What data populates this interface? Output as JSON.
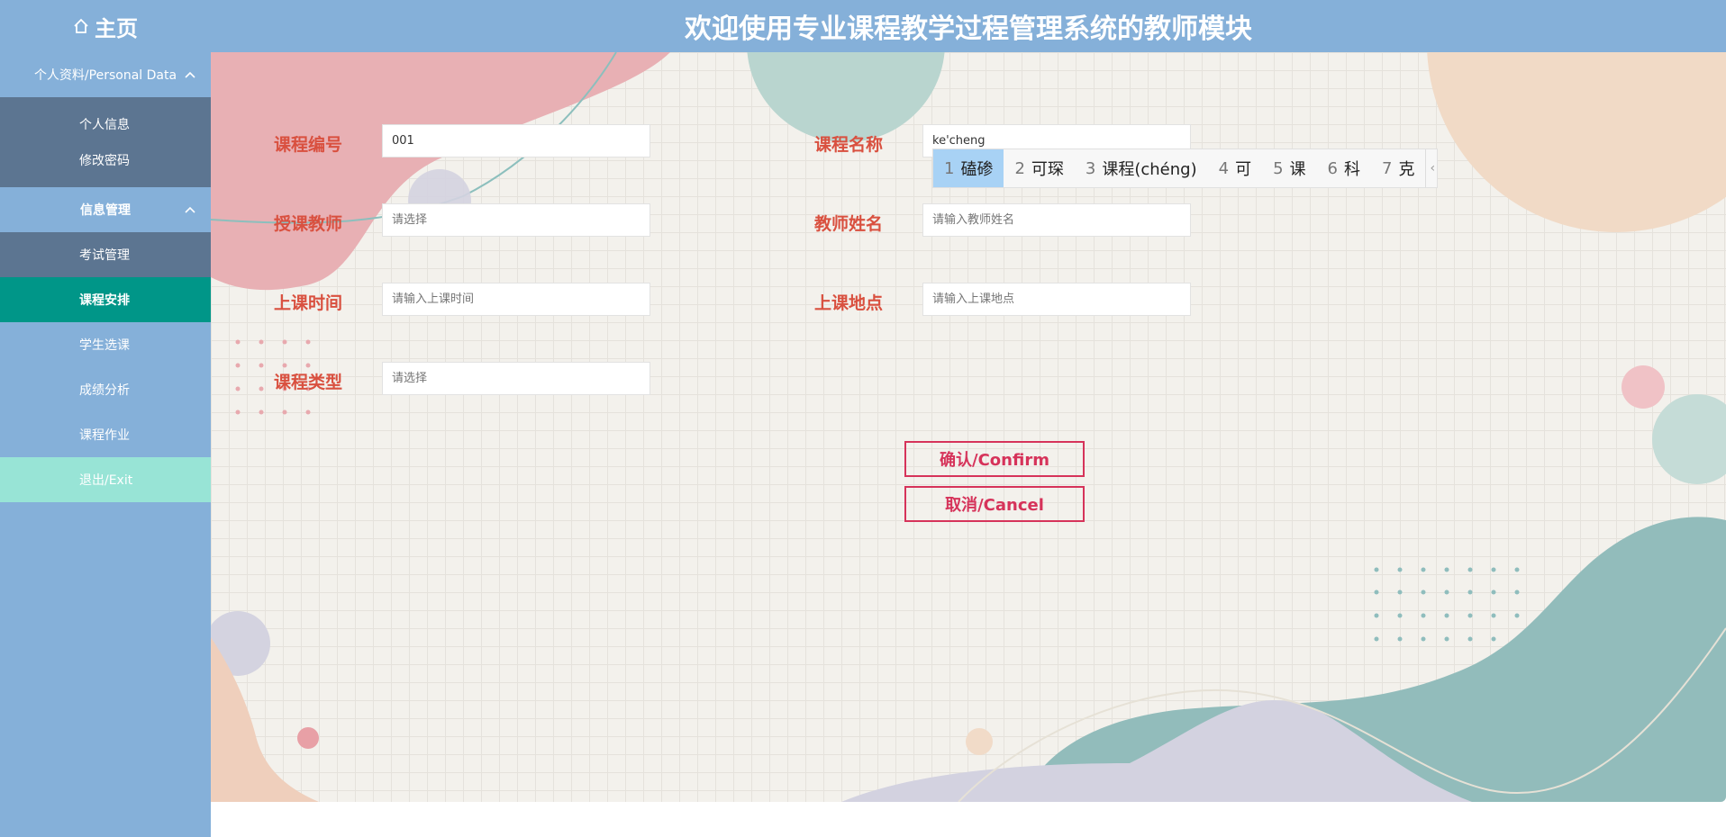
{
  "header": {
    "home_label": "主页",
    "title": "欢迎使用专业课程教学过程管理系统的教师模块"
  },
  "sidebar": {
    "groups": [
      {
        "label": "个人资料/Personal Data",
        "items": [
          "个人信息",
          "修改密码"
        ]
      },
      {
        "label": "信息管理",
        "items": [
          "考试管理",
          "课程安排",
          "学生选课",
          "成绩分析",
          "课程作业",
          "退出/Exit"
        ]
      }
    ],
    "active_item": "课程安排"
  },
  "form": {
    "course_id": {
      "label": "课程编号",
      "value": "001",
      "placeholder": ""
    },
    "course_name": {
      "label": "课程名称",
      "value": "ke'cheng",
      "placeholder": ""
    },
    "teacher": {
      "label": "授课教师",
      "value": "",
      "placeholder": "请选择"
    },
    "teacher_name": {
      "label": "教师姓名",
      "value": "",
      "placeholder": "请输入教师姓名"
    },
    "class_time": {
      "label": "上课时间",
      "value": "",
      "placeholder": "请输入上课时间"
    },
    "class_location": {
      "label": "上课地点",
      "value": "",
      "placeholder": "请输入上课地点"
    },
    "course_type": {
      "label": "课程类型",
      "value": "",
      "placeholder": "请选择"
    }
  },
  "buttons": {
    "confirm": "确认/Confirm",
    "cancel": "取消/Cancel"
  },
  "ime": {
    "candidates": [
      {
        "num": "1",
        "text": "磕碜"
      },
      {
        "num": "2",
        "text": "可琛"
      },
      {
        "num": "3",
        "text": "课程(chéng)"
      },
      {
        "num": "4",
        "text": "可"
      },
      {
        "num": "5",
        "text": "课"
      },
      {
        "num": "6",
        "text": "科"
      },
      {
        "num": "7",
        "text": "克"
      }
    ],
    "more": "‹"
  },
  "colors": {
    "header_bg": "#85b0d9",
    "sidebar_sub_bg": "#5c7591",
    "active_bg": "#009688",
    "exit_bg": "#98e4d6",
    "label_color": "#d9503f",
    "button_color": "#d6335a"
  }
}
